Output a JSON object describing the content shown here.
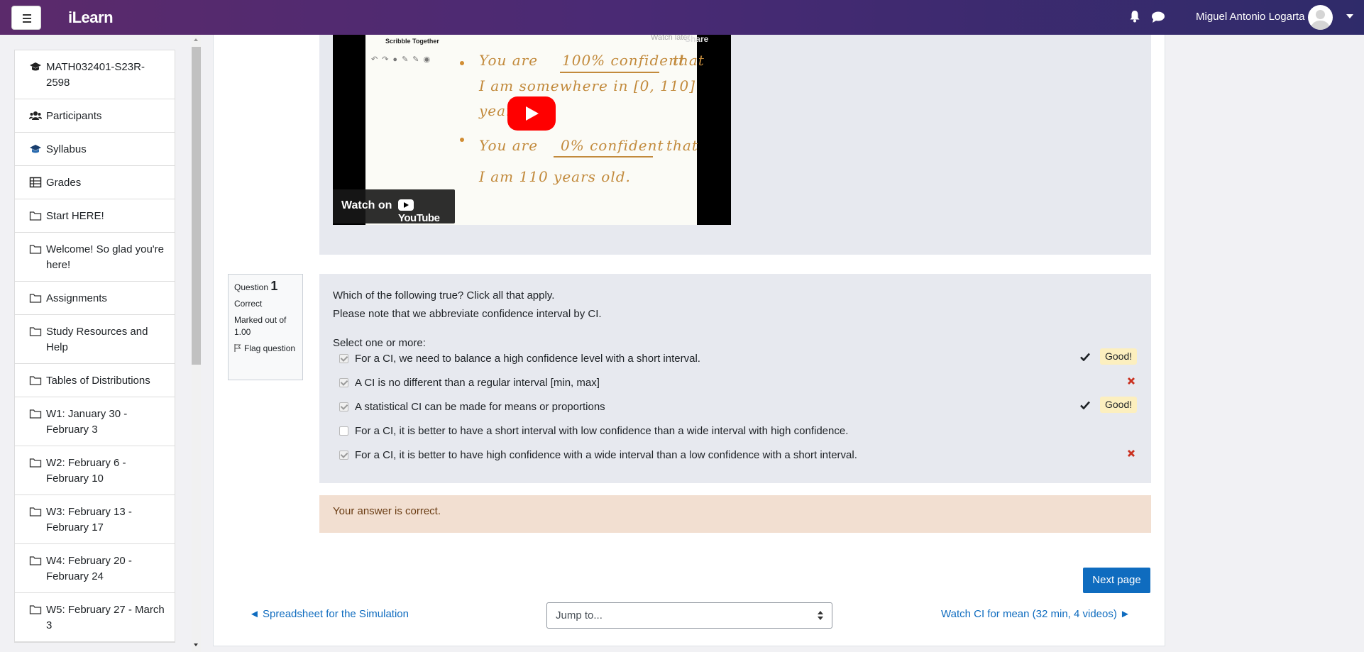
{
  "app": {
    "brand": "iLearn",
    "user_name": "Miguel Antonio Logarta"
  },
  "sidebar": {
    "items": [
      {
        "label": "MATH032401-S23R-2598",
        "icon": "graduation-cap-icon"
      },
      {
        "label": "Participants",
        "icon": "users-icon"
      },
      {
        "label": "Syllabus",
        "icon": "graduation-cap-blue-icon"
      },
      {
        "label": "Grades",
        "icon": "table-icon"
      },
      {
        "label": "Start HERE!",
        "icon": "folder-icon"
      },
      {
        "label": "Welcome! So glad you're here!",
        "icon": "folder-icon"
      },
      {
        "label": "Assignments",
        "icon": "folder-icon"
      },
      {
        "label": "Study Resources and Help",
        "icon": "folder-icon"
      },
      {
        "label": "Tables of Distributions",
        "icon": "folder-icon"
      },
      {
        "label": "W1: January 30 - February 3",
        "icon": "folder-icon"
      },
      {
        "label": "W2: February 6 - February 10",
        "icon": "folder-icon"
      },
      {
        "label": "W3: February 13 - February 17",
        "icon": "folder-icon"
      },
      {
        "label": "W4: February 20 - February 24",
        "icon": "folder-icon"
      },
      {
        "label": "W5: February 27 - March 3",
        "icon": "folder-icon"
      }
    ]
  },
  "video": {
    "channel": "Scribble Together",
    "watch_later": "Watch later",
    "share": "Share",
    "watch_on": "Watch on",
    "youtube": "YouTube",
    "line1a": "You are",
    "line1b": "100% confident",
    "line1c": "that",
    "line2": "I am somewhere in [0, 110]",
    "line3": "years",
    "line4a": "You are",
    "line4b": "0% confident",
    "line4c": "that",
    "line5": "I am  110  years  old."
  },
  "question": {
    "label": "Question",
    "number": "1",
    "state": "Correct",
    "marked": "Marked out of 1.00",
    "flag": "Flag question",
    "text1": "Which of the following true? Click all that apply.",
    "text2": "Please note that we abbreviate confidence interval by CI.",
    "select_label": "Select one or more:",
    "answers": [
      {
        "text": "For a CI, we need to balance a high confidence level with a short interval.",
        "checked": true,
        "result": "correct",
        "feedback": "Good!"
      },
      {
        "text": "A CI is no different than a regular interval [min, max]",
        "checked": true,
        "result": "incorrect",
        "feedback": ""
      },
      {
        "text": "A statistical CI can be made for means or proportions",
        "checked": true,
        "result": "correct",
        "feedback": "Good!"
      },
      {
        "text": "For a CI, it is better to have a short interval with low confidence than a wide interval with high confidence.",
        "checked": false,
        "result": "none",
        "feedback": ""
      },
      {
        "text": "For a CI, it is better to have high confidence with a wide interval than a low confidence with a short interval.",
        "checked": true,
        "result": "incorrect",
        "feedback": ""
      }
    ],
    "general_feedback": "Your answer is correct."
  },
  "navigation": {
    "next_page": "Next page",
    "prev_link": "◄ Spreadsheet for the Simulation",
    "jump_placeholder": "Jump to...",
    "next_link": "Watch CI for mean (32 min, 4 videos) ►"
  },
  "colors": {
    "navbar_start": "#5b2a6b",
    "navbar_end": "#2f2b6a",
    "primary": "#0f6cbf",
    "feedback_bg": "#f2dfd1",
    "good_badge": "#fcefbf",
    "incorrect": "#ca3120"
  }
}
